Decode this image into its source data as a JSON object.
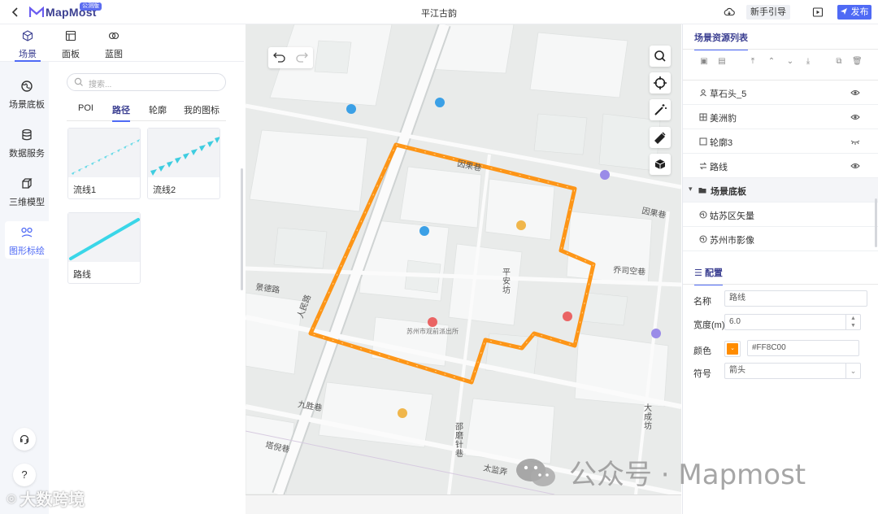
{
  "app": {
    "logo_text": "MapMost",
    "logo_badge": "公测版",
    "title": "平江古韵",
    "guide_label": "新手引导",
    "publish_label": "发布"
  },
  "top_tabs": [
    {
      "label": "场景",
      "icon": "scene-icon",
      "active": true
    },
    {
      "label": "面板",
      "icon": "panel-icon",
      "active": false
    },
    {
      "label": "蓝图",
      "icon": "blueprint-icon",
      "active": false
    }
  ],
  "rail": [
    {
      "label": "场景底板",
      "icon": "globe-icon",
      "active": false
    },
    {
      "label": "数据服务",
      "icon": "database-icon",
      "active": false
    },
    {
      "label": "三维模型",
      "icon": "cube-icon",
      "active": false
    },
    {
      "label": "图形标绘",
      "icon": "shapes-icon",
      "active": true
    }
  ],
  "left_panel": {
    "search_placeholder": "搜索...",
    "subtabs": [
      "POI",
      "路径",
      "轮廓",
      "我的图标"
    ],
    "active_subtab": "路径",
    "cards": [
      {
        "label": "流线1",
        "style": "dotted-arrow-line"
      },
      {
        "label": "流线2",
        "style": "triangle-arrow-line"
      },
      {
        "label": "路线",
        "style": "solid-line"
      }
    ]
  },
  "map": {
    "street_labels": [
      "因果巷",
      "因果巷",
      "乔司空巷",
      "平安坊",
      "景德路",
      "人民路",
      "九胜巷",
      "邵磨针巷",
      "塔倪巷",
      "太监弄",
      "大成坊"
    ],
    "poi_label": "苏州市观前派出所",
    "route_color": "#FF8C00"
  },
  "right_panel": {
    "title": "场景资源列表",
    "resources": [
      {
        "name": "草石头_5",
        "icon": "model-icon"
      },
      {
        "name": "美洲豹",
        "icon": "model-icon"
      },
      {
        "name": "轮廓3",
        "icon": "outline-icon"
      },
      {
        "name": "路线",
        "icon": "route-icon"
      },
      {
        "name": "场景底板",
        "icon": "folder-icon",
        "folder": true
      },
      {
        "name": "姑苏区矢量",
        "icon": "globe-icon"
      },
      {
        "name": "苏州市影像",
        "icon": "globe-icon"
      }
    ],
    "config_title": "配置",
    "config": {
      "name_label": "名称",
      "name_value": "路线",
      "width_label": "宽度(m)",
      "width_value": "6.0",
      "color_label": "颜色",
      "color_value": "#FF8C00",
      "symbol_label": "符号",
      "symbol_value": "箭头"
    }
  },
  "watermarks": {
    "wechat": "公众号 · Mapmost",
    "brand": "大数跨境"
  }
}
